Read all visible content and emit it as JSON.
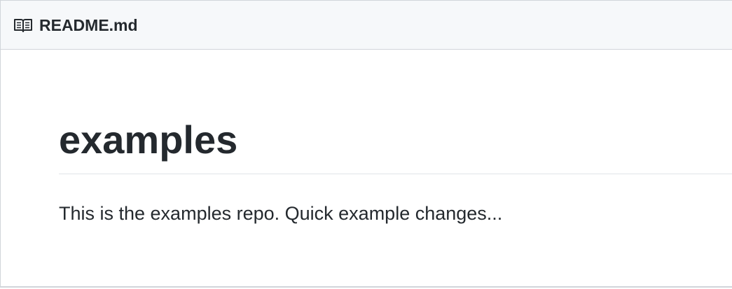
{
  "readme": {
    "file_name": "README.md",
    "icon": "book-icon",
    "heading": "examples",
    "paragraph": "This is the examples repo. Quick example changes..."
  },
  "colors": {
    "text": "#24292e",
    "header_background": "#f6f8fa",
    "border": "#d1d5da",
    "divider": "#e1e4e8"
  }
}
